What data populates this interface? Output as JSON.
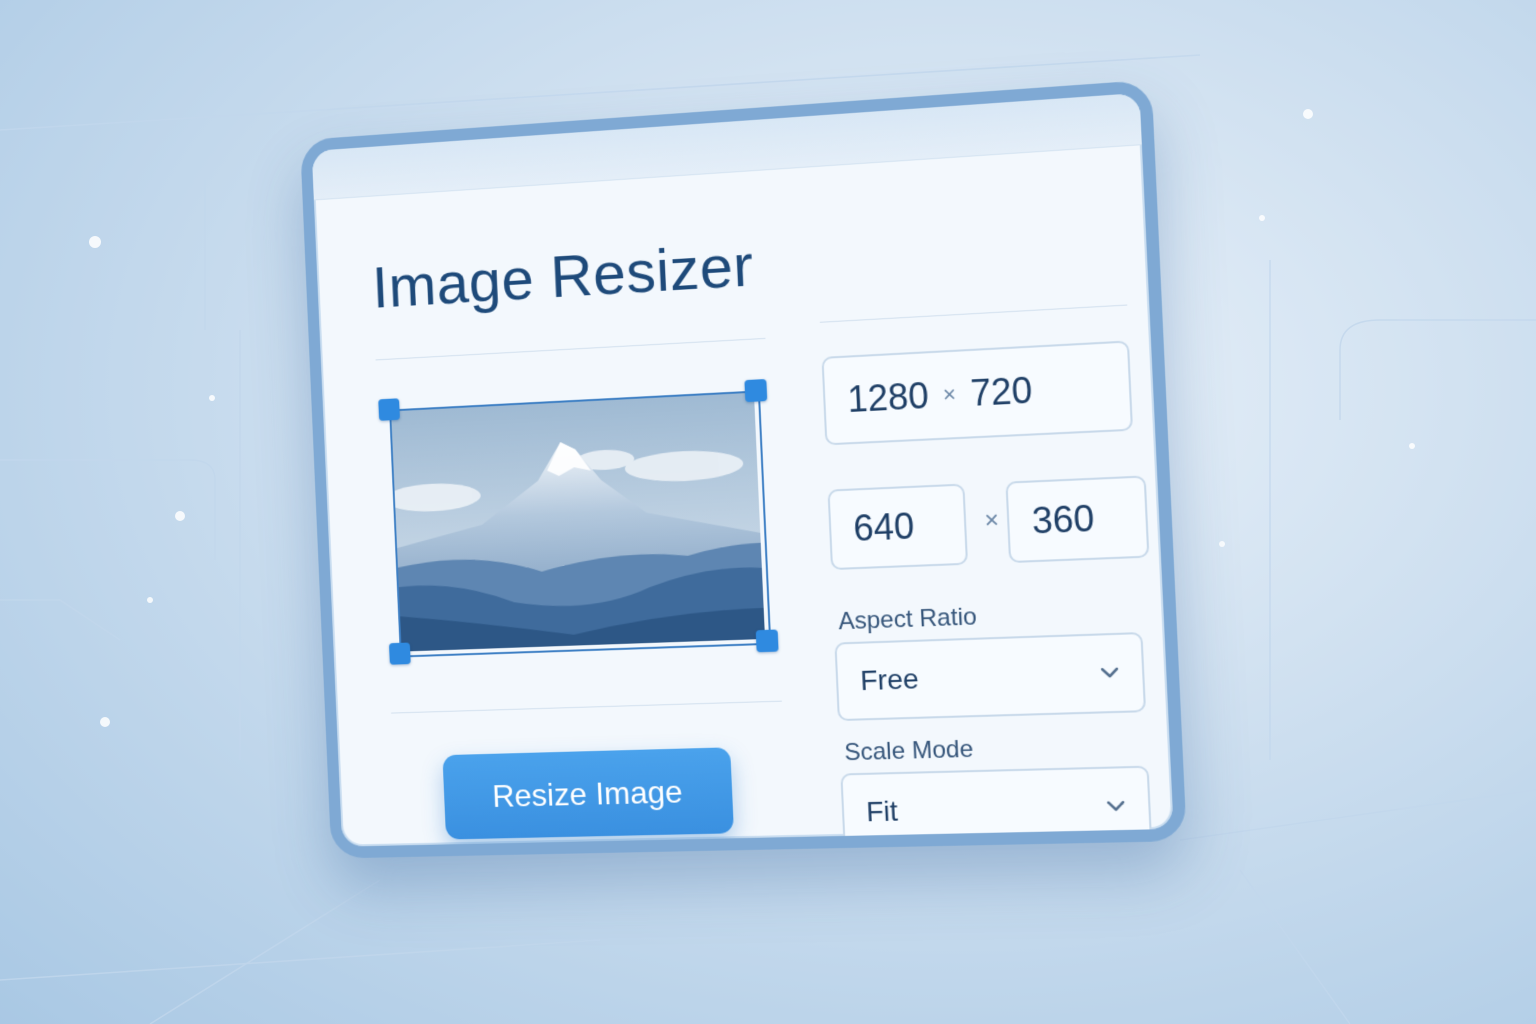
{
  "window": {
    "title": "Image Resizer"
  },
  "original_size": {
    "width": "1280",
    "height": "720",
    "separator": "×"
  },
  "new_size": {
    "width": "640",
    "height": "360",
    "separator": "×"
  },
  "aspect_ratio": {
    "label": "Aspect Ratio",
    "selected": "Free"
  },
  "scale_mode": {
    "label": "Scale Mode",
    "selected": "Fit"
  },
  "actions": {
    "resize_label": "Resize Image"
  },
  "icons": {
    "dropdown": "chevron-down-icon",
    "handle": "resize-handle"
  },
  "colors": {
    "accent": "#3a90e0",
    "title": "#1e4a7a",
    "frame": "#7fa9d4",
    "background": "#cfe0f0"
  }
}
